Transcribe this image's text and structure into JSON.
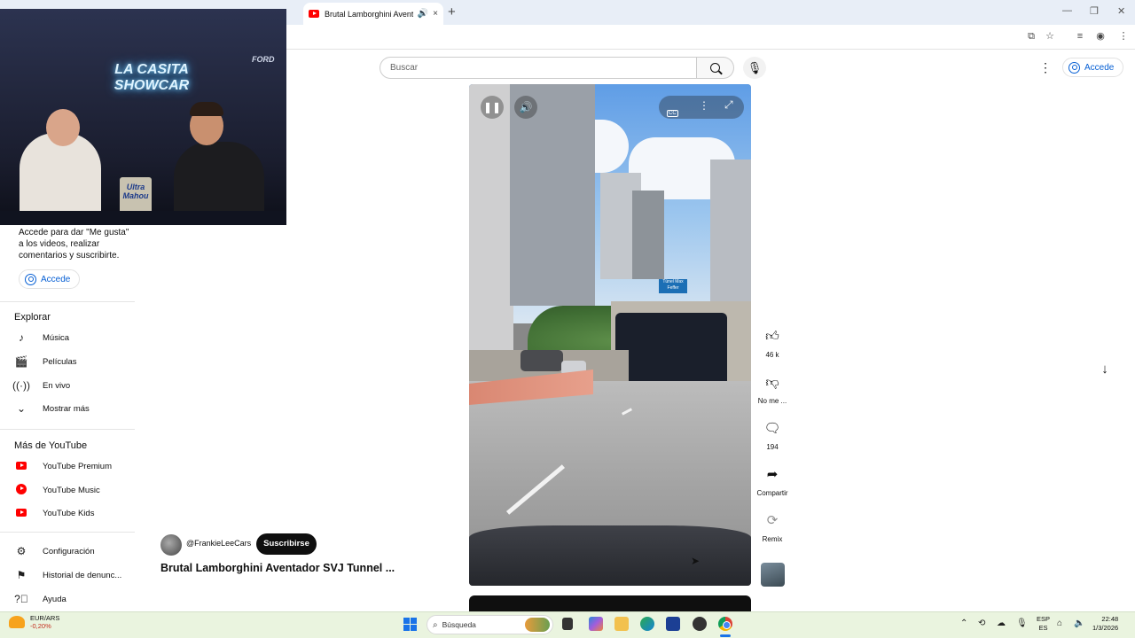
{
  "browser": {
    "tab_title": "Brutal Lamborghini Aventad",
    "tab_close": "×",
    "new_tab": "+",
    "tab_audio_icon": "speaker-icon"
  },
  "youtube": {
    "search": {
      "placeholder": "Buscar"
    },
    "sign_in_label": "Accede",
    "sidebar": {
      "signin_note": "Accede para dar \"Me gusta\" a los videos, realizar comentarios y suscribirte.",
      "signin_button": "Accede",
      "explore_title": "Explorar",
      "explore_items": [
        {
          "label": "Música",
          "icon": "music-note-icon"
        },
        {
          "label": "Películas",
          "icon": "clapperboard-icon"
        },
        {
          "label": "En vivo",
          "icon": "live-icon"
        },
        {
          "label": "Mostrar más",
          "icon": "chevron-down-icon"
        }
      ],
      "more_title": "Más de YouTube",
      "more_items": [
        {
          "label": "YouTube Premium",
          "icon": "youtube-premium-icon"
        },
        {
          "label": "YouTube Music",
          "icon": "youtube-music-icon"
        },
        {
          "label": "YouTube Kids",
          "icon": "youtube-kids-icon"
        }
      ],
      "settings_items": [
        {
          "label": "Configuración",
          "icon": "gear-icon"
        },
        {
          "label": "Historial de denunc...",
          "icon": "flag-icon"
        },
        {
          "label": "Ayuda",
          "icon": "help-icon"
        }
      ]
    },
    "video": {
      "channel": "@FrankieLeeCars",
      "subscribe": "Suscribirse",
      "title": "Brutal Lamborghini Aventador SVJ Tunnel ...",
      "tunnel_sign": "Túnel Max Feffer",
      "actions": [
        {
          "label": "46 k",
          "icon": "thumbs-up-icon"
        },
        {
          "label": "No me ...",
          "icon": "thumbs-down-icon"
        },
        {
          "label": "194",
          "icon": "comment-icon"
        },
        {
          "label": "Compartir",
          "icon": "share-icon"
        },
        {
          "label": "Remix",
          "icon": "remix-icon"
        }
      ]
    },
    "pip": {
      "neon_sign": "LA CASITA SHOWCAR",
      "brand_text": "FORD",
      "can_text": "Ultra Mahou"
    }
  },
  "taskbar": {
    "ticker_name": "EUR/ARS",
    "ticker_change": "-0,20%",
    "search_placeholder": "Búsqueda",
    "lang_1": "ESP",
    "lang_2": "ES",
    "time": "22:48",
    "date": "1/3/2026"
  }
}
